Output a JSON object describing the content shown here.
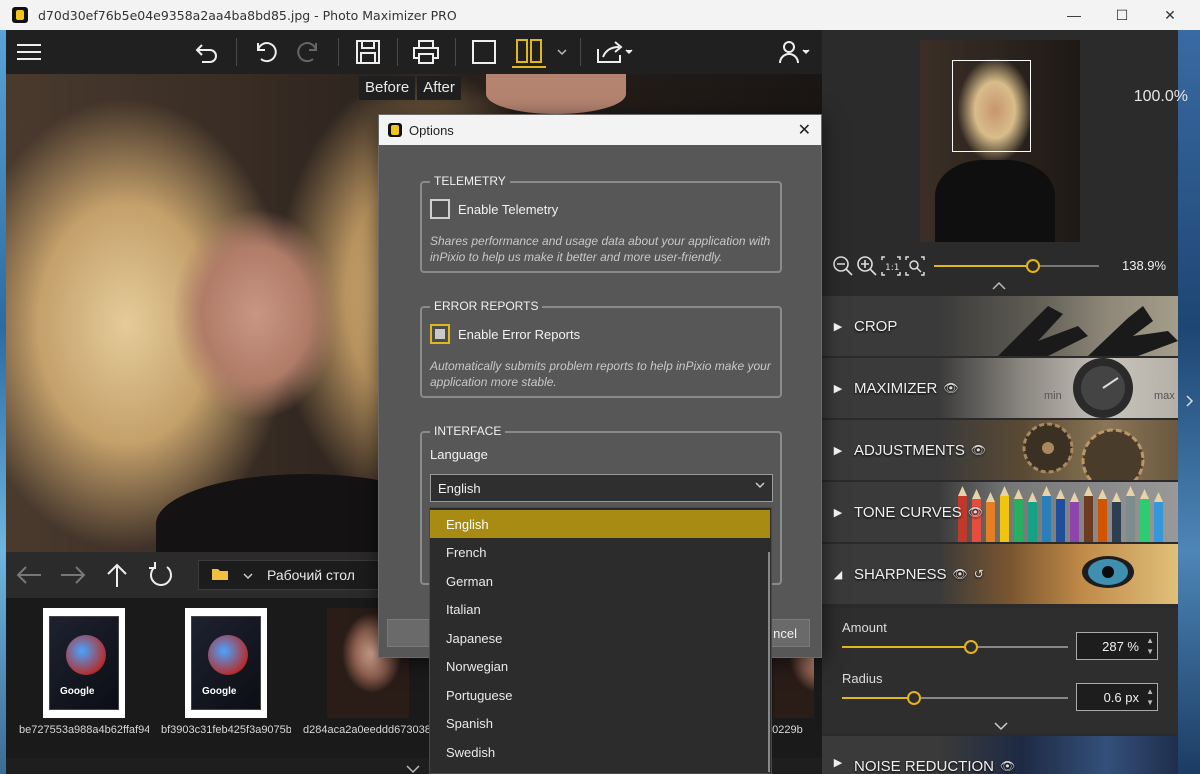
{
  "window": {
    "title": "d70d30ef76b5e04e9358a2aa4ba8bd85.jpg - Photo Maximizer PRO",
    "minimize_glyph": "—",
    "maximize_glyph": "☐",
    "close_glyph": "✕"
  },
  "toolbar": {
    "menu_icon": "hamburger-icon",
    "buttons": [
      "undo-all",
      "undo",
      "redo",
      "save",
      "print",
      "single-view",
      "split-view",
      "share",
      "account"
    ],
    "before_label": "Before",
    "after_label": "After",
    "accent_color": "#e0b81a"
  },
  "viewer": {
    "zoom": "100.0%"
  },
  "navigation": {
    "folder": "Рабочий стол"
  },
  "filmstrip": {
    "items": [
      {
        "name": "be727553a988a4b62ffaf941...",
        "thumb_text": "Google"
      },
      {
        "name": "bf3903c31feb425f3a9075b4...",
        "thumb_text": "Google"
      },
      {
        "name": "d284aca2a0eeddd673038b",
        "thumb_text": ""
      },
      {
        "name": "e0229b",
        "thumb_text": ""
      }
    ]
  },
  "right_panel": {
    "zoom_percent": "138.9%",
    "zoom_level_fraction": 0.6,
    "sections": [
      {
        "label": "CROP",
        "expanded": false,
        "eye": false
      },
      {
        "label": "MAXIMIZER",
        "expanded": false,
        "eye": true,
        "min_label": "min",
        "max_label": "max"
      },
      {
        "label": "ADJUSTMENTS",
        "expanded": false,
        "eye": true
      },
      {
        "label": "TONE CURVES",
        "expanded": false,
        "eye": true
      },
      {
        "label": "SHARPNESS",
        "expanded": true,
        "eye": true
      },
      {
        "label": "NOISE REDUCTION",
        "expanded": false,
        "eye": true
      }
    ],
    "sharpness": {
      "amount_label": "Amount",
      "amount_value": "287 %",
      "amount_fraction": 0.57,
      "radius_label": "Radius",
      "radius_value": "0.6 px",
      "radius_fraction": 0.32
    }
  },
  "dialog": {
    "title": "Options",
    "close_glyph": "✕",
    "telemetry": {
      "legend": "TELEMETRY",
      "checkbox_label": "Enable Telemetry",
      "checked": false,
      "description": "Shares performance and usage data about your application with inPixio to help us make it better and more user-friendly."
    },
    "error_reports": {
      "legend": "ERROR REPORTS",
      "checkbox_label": "Enable Error Reports",
      "checked": false,
      "description": "Automatically submits problem reports to help inPixio make your application more stable."
    },
    "interface": {
      "legend": "INTERFACE",
      "language_label": "Language",
      "language_value": "English"
    },
    "cancel_partial": "ncel"
  },
  "language_dropdown": {
    "options": [
      "English",
      "French",
      "German",
      "Italian",
      "Japanese",
      "Norwegian",
      "Portuguese",
      "Spanish",
      "Swedish"
    ],
    "selected": "English"
  }
}
